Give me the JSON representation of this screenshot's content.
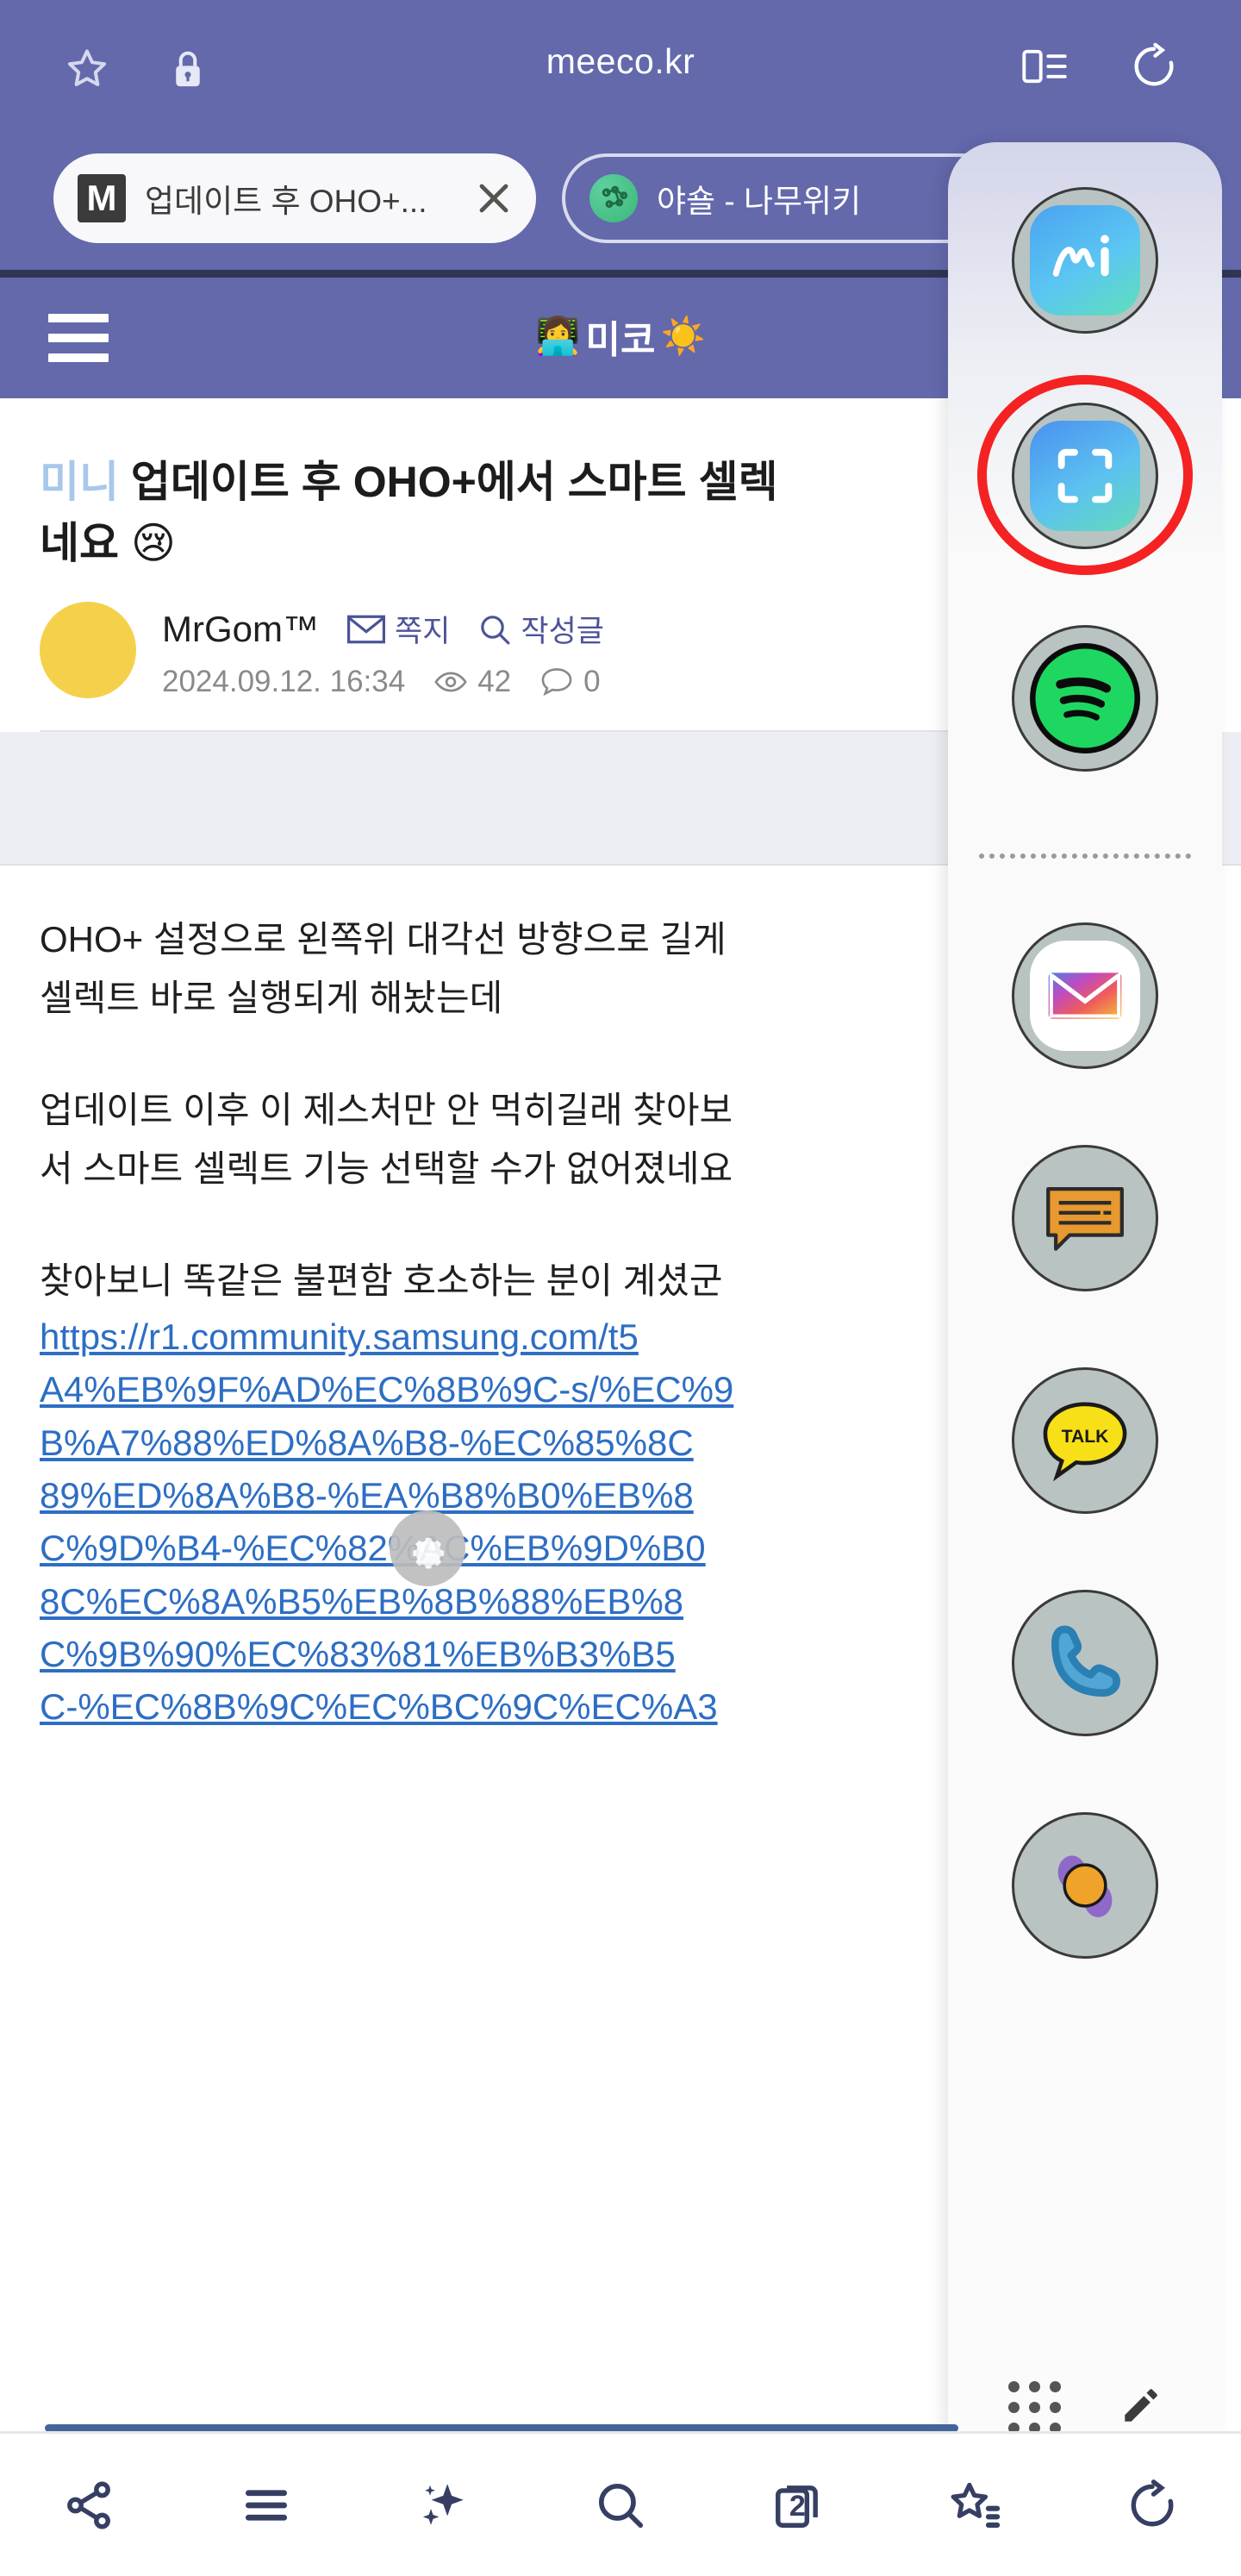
{
  "browser": {
    "url": "meeco.kr",
    "icons": {
      "bookmark_star": "star-icon",
      "lock": "lock-icon",
      "reader": "reader-view-icon",
      "reload": "reload-icon"
    },
    "tabs": [
      {
        "favicon_letter": "M",
        "title": "업데이트 후 OHO+...",
        "active": true,
        "close_label": "✕"
      },
      {
        "favicon_letter": "",
        "title": "야숄 - 나무위키",
        "active": false,
        "close_label": "✕"
      }
    ]
  },
  "site": {
    "logo_emoji": "👩‍💻",
    "logo_text": "미코",
    "logo_suffix_emoji": "☀️",
    "menu_label": "메뉴"
  },
  "article": {
    "category": "미니",
    "title": "업데이트 후 OHO+에서 스마트 셀렉",
    "title_line2": "네요",
    "title_emoji": "😢",
    "author": "MrGom™",
    "message_link": "쪽지",
    "posts_link": "작성글",
    "date": "2024.09.12. 16:34",
    "views": "42",
    "comments": "0",
    "paragraphs": [
      "OHO+ 설정으로 왼쪽위 대각선 방향으로 길게",
      "셀렉트 바로 실행되게 해놨는데",
      "업데이트 이후 이 제스처만 안 먹히길래 찾아보",
      "서 스마트 셀렉트 기능 선택할 수가 없어졌네요",
      "찾아보니 똑같은 불편함 호소하는 분이 계셨군"
    ],
    "link_lines": [
      "https://r1.community.samsung.com/t5",
      "A4%EB%9F%AD%EC%8B%9C-s/%EC%9",
      "B%A7%88%ED%8A%B8-%EC%85%8C",
      "89%ED%8A%B8-%EA%B8%B0%EB%8",
      "C%9D%B4-%EC%82%AC%EB%9D%B0",
      "8C%EC%8A%B5%EB%8B%88%EB%8",
      "C%9B%90%EC%83%81%EB%B3%B5",
      "C-%EC%8B%9C%EC%BC%9C%EC%A3"
    ]
  },
  "edge_panel": {
    "apps": [
      {
        "name": "samsung-notes-ai",
        "label": "Mi"
      },
      {
        "name": "smart-select-scan",
        "label": "",
        "highlighted": true
      },
      {
        "name": "spotify",
        "label": ""
      },
      {
        "name": "gmail",
        "label": ""
      },
      {
        "name": "messages",
        "label": ""
      },
      {
        "name": "kakaotalk",
        "label": "TALK"
      },
      {
        "name": "phone",
        "label": ""
      },
      {
        "name": "photo-editor",
        "label": ""
      }
    ],
    "footer": {
      "apps_grid": "apps-grid-icon",
      "edit": "edit-pencil-icon"
    }
  },
  "bottom_nav": {
    "items": [
      {
        "name": "share",
        "label": "공유"
      },
      {
        "name": "menu",
        "label": "메뉴"
      },
      {
        "name": "ai-assist",
        "label": "AI"
      },
      {
        "name": "search",
        "label": "검색"
      },
      {
        "name": "tabs",
        "label": "탭",
        "count": "2"
      },
      {
        "name": "bookmarks",
        "label": "북마크"
      },
      {
        "name": "refresh",
        "label": "새로고침"
      }
    ]
  },
  "colors": {
    "chrome_purple": "#6369AB",
    "chrome_divider": "#303553",
    "accent_link": "#2D6EC4",
    "highlight_ring": "#F42222",
    "avatar": "#F5D14B",
    "nav_icon": "#363F63"
  }
}
